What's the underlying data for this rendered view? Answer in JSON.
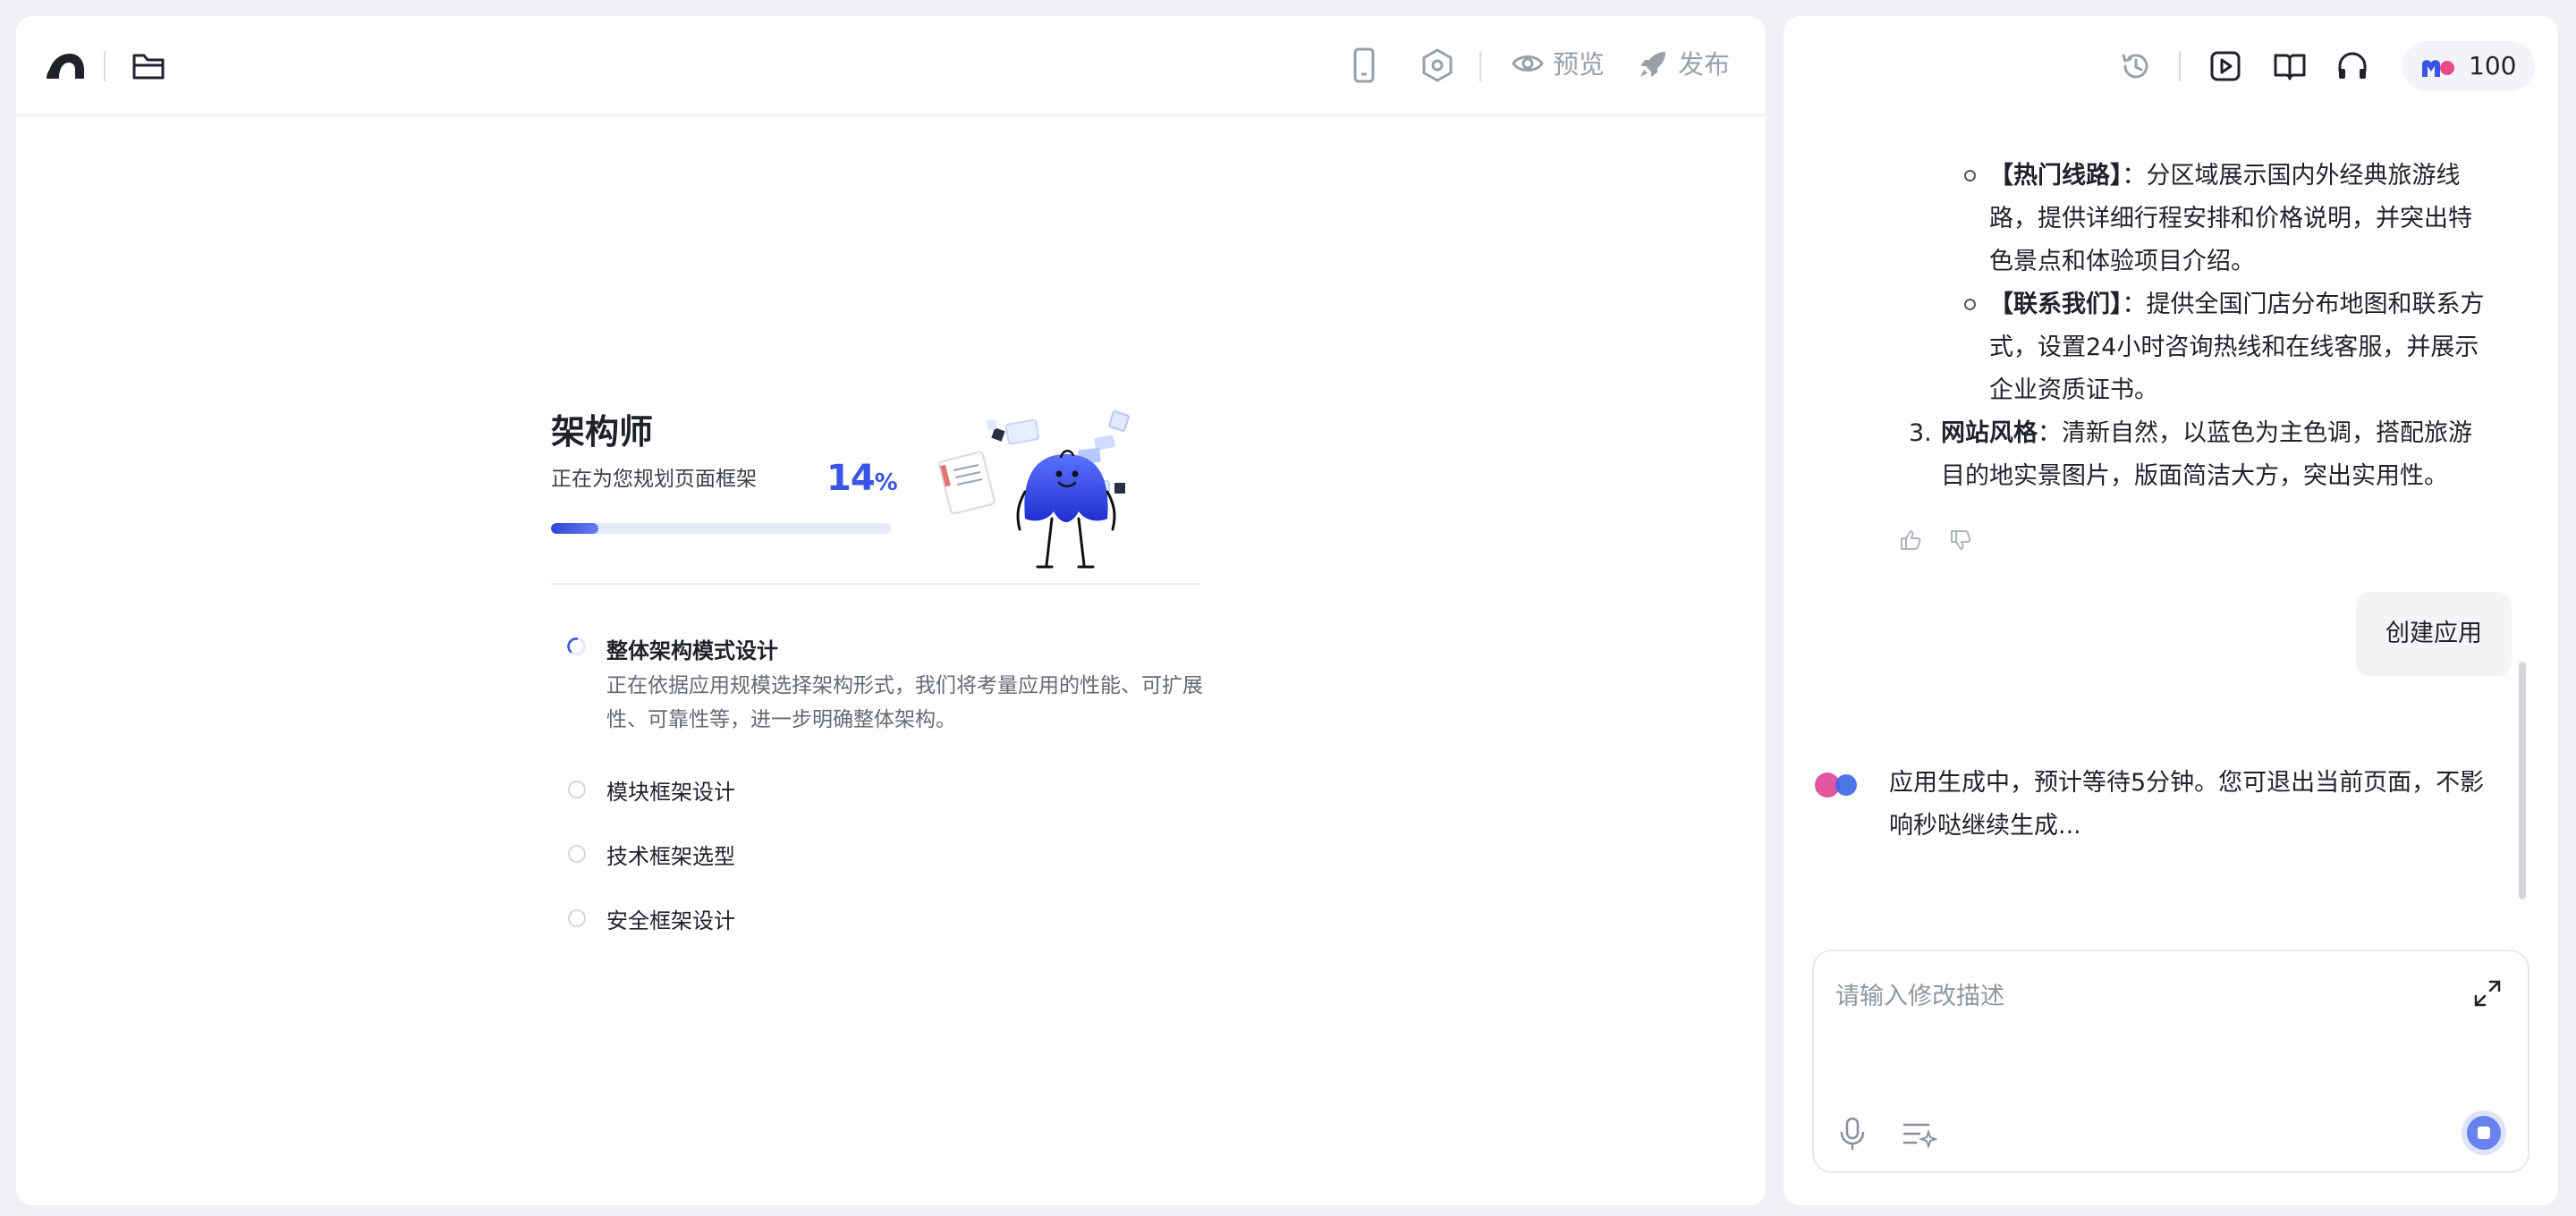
{
  "left_toolbar": {
    "preview_label": "预览",
    "publish_label": "发布"
  },
  "right_toolbar": {
    "credits": "100"
  },
  "progress_card": {
    "title": "架构师",
    "subtitle": "正在为您规划页面框架",
    "percent": "14",
    "percent_sign": "%",
    "progress_fraction": 0.14,
    "steps": [
      {
        "label": "整体架构模式设计",
        "status": "in-progress",
        "description": "正在依据应用规模选择架构形式，我们将考量应用的性能、可扩展性、可靠性等，进一步明确整体架构。"
      },
      {
        "label": "模块框架设计",
        "status": "pending"
      },
      {
        "label": "技术框架选型",
        "status": "pending"
      },
      {
        "label": "安全框架设计",
        "status": "pending"
      }
    ]
  },
  "chat": {
    "sub_items": [
      {
        "bold": "【热门线路】",
        "lines": [
          "：分区域展示国内外经典旅游线",
          "路，提供详细行程安排和价格说明，并突出特",
          "色景点和体验项目介绍。"
        ]
      },
      {
        "bold": "【联系我们】",
        "lines": [
          "：提供全国门店分布地图和联系方",
          "式，设置24小时咨询热线和在线客服，并展示",
          "企业资质证书。"
        ]
      }
    ],
    "numbered_item": {
      "number": "3.",
      "bold": "网站风格",
      "lines": [
        "：清新自然，以蓝色为主色调，搭配旅游",
        "目的地实景图片，版面简洁大方，突出实用性。"
      ]
    },
    "user_message": "创建应用",
    "bot_message_lines": [
      "应用生成中，预计等待5分钟。您可退出当前页面，不影",
      "响秒哒继续生成..."
    ]
  },
  "input": {
    "placeholder": "请输入修改描述"
  },
  "colors": {
    "accent": "#3a55e6",
    "background": "#eef0f3"
  }
}
